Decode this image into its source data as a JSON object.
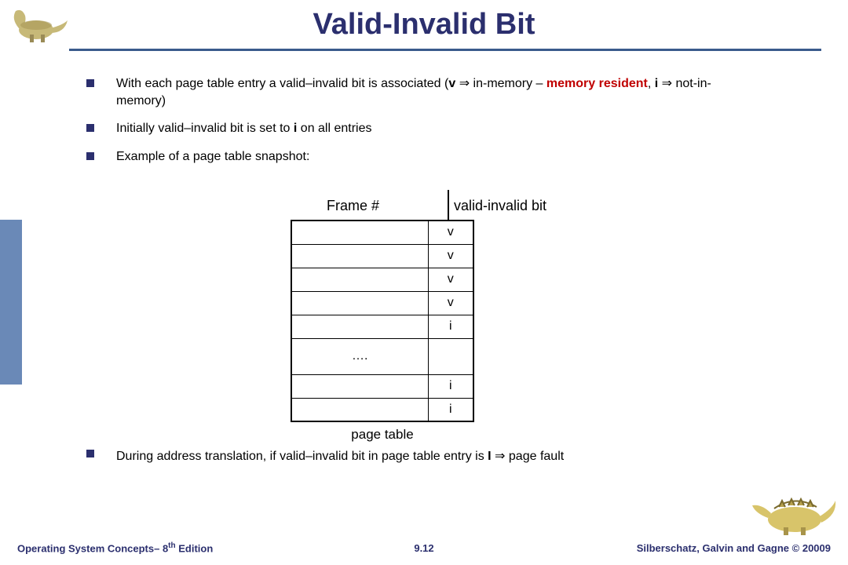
{
  "title": "Valid-Invalid Bit",
  "bullets": [
    {
      "pre": "With each page table entry a valid–invalid bit is associated (",
      "b1": "v",
      "mid1": " ⇒ in-memory – ",
      "resident": "memory resident",
      "mid2": ", ",
      "b2": "i",
      "post": " ⇒ not-in-memory)"
    },
    {
      "pre": "Initially valid–invalid bit is set to ",
      "b1": "i",
      "post": " on all entries"
    },
    {
      "pre": "Example of a page table snapshot:"
    }
  ],
  "table": {
    "header_frame": "Frame #",
    "header_bit": "valid-invalid bit",
    "rows": [
      {
        "frame": "",
        "bit": "v"
      },
      {
        "frame": "",
        "bit": "v"
      },
      {
        "frame": "",
        "bit": "v"
      },
      {
        "frame": "",
        "bit": "v"
      },
      {
        "frame": "",
        "bit": "i"
      },
      {
        "frame": "….",
        "bit": ""
      },
      {
        "frame": "",
        "bit": "i"
      },
      {
        "frame": "",
        "bit": "i"
      }
    ],
    "caption": "page table"
  },
  "bottom_bullet": {
    "pre": "During address translation, if valid–invalid bit in page table entry is ",
    "b1": "I",
    "post": " ⇒ page fault"
  },
  "footer": {
    "left_a": "Operating System Concepts– 8",
    "left_sup": "th",
    "left_b": " Edition",
    "center": "9.12",
    "right": "Silberschatz, Galvin and Gagne © 20009"
  },
  "icons": {
    "top_left": "dinosaur-icon",
    "bottom_right": "dinosaur-icon"
  }
}
